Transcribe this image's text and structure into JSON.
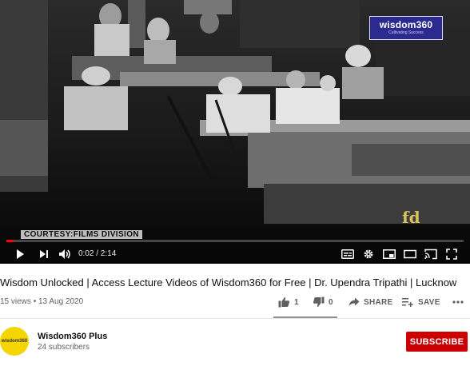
{
  "player": {
    "watermark_logo_text": "wisdom360",
    "watermark_logo_sub": "Cultivating Success",
    "caption_courtesy": "COURTESY:FILMS DIVISION",
    "caption_fd": "fd",
    "progress_fraction": 0.016,
    "time_display": "0:02 / 2:14",
    "icons": [
      "play-icon",
      "next-icon",
      "volume-icon",
      "subtitles-icon",
      "settings-icon",
      "miniplayer-icon",
      "theater-icon",
      "cast-icon",
      "fullscreen-icon"
    ],
    "accent_color": "#ff0000"
  },
  "video": {
    "title": "Wisdom Unlocked | Access Lecture Videos of Wisdom360 for Free | Dr. Upendra Tripathi | Lucknow",
    "views": "15 views",
    "separator": "•",
    "date": "13 Aug 2020"
  },
  "actions": {
    "like_count": "1",
    "dislike_count": "0",
    "share_label": "SHARE",
    "save_label": "SAVE"
  },
  "channel": {
    "name": "Wisdom360 Plus",
    "subscribers": "24 subscribers",
    "avatar_text": "wisdom360",
    "avatar_color": "#f5d500"
  },
  "subscribe": {
    "label": "SUBSCRIBE",
    "color": "#cc0000"
  }
}
